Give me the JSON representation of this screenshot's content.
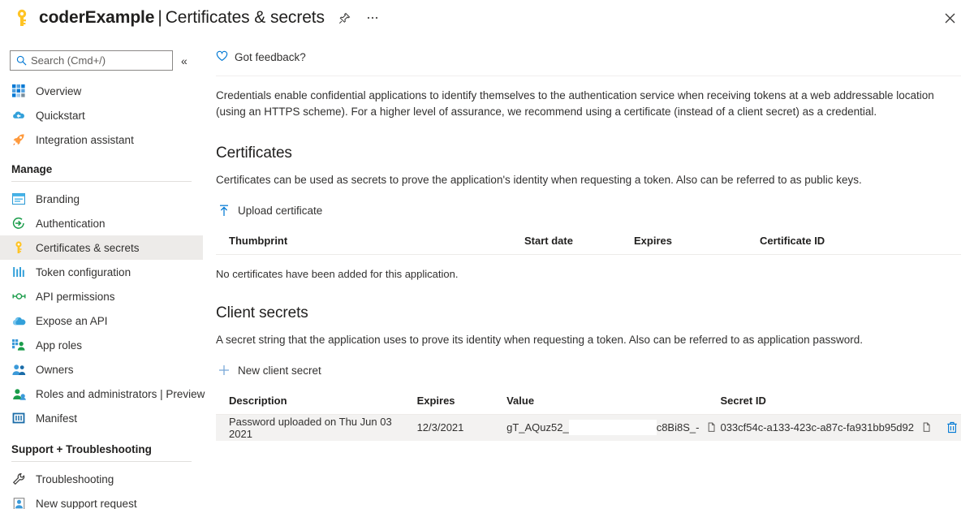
{
  "titlebar": {
    "key_icon": "key-icon",
    "app_name": "coderExample",
    "separator": "|",
    "page_name": "Certificates & secrets",
    "pin_icon": "pin-icon",
    "more_icon": "ellipsis-icon",
    "close_icon": "close-icon"
  },
  "sidebar": {
    "search": {
      "placeholder": "Search (Cmd+/)",
      "value": "",
      "icon": "search-icon"
    },
    "collapse_icon": "chevron-double-left-icon",
    "top_items": [
      {
        "label": "Overview",
        "icon": "overview-grid-icon",
        "selected": false
      },
      {
        "label": "Quickstart",
        "icon": "quickstart-cloud-icon",
        "selected": false
      },
      {
        "label": "Integration assistant",
        "icon": "rocket-icon",
        "selected": false
      }
    ],
    "groups": [
      {
        "title": "Manage",
        "items": [
          {
            "label": "Branding",
            "icon": "branding-window-icon",
            "selected": false
          },
          {
            "label": "Authentication",
            "icon": "authentication-arrow-icon",
            "selected": false
          },
          {
            "label": "Certificates & secrets",
            "icon": "key-icon",
            "selected": true
          },
          {
            "label": "Token configuration",
            "icon": "token-bars-icon",
            "selected": false
          },
          {
            "label": "API permissions",
            "icon": "api-permissions-icon",
            "selected": false
          },
          {
            "label": "Expose an API",
            "icon": "expose-api-cloud-icon",
            "selected": false
          },
          {
            "label": "App roles",
            "icon": "app-roles-icon",
            "selected": false
          },
          {
            "label": "Owners",
            "icon": "owners-people-icon",
            "selected": false
          },
          {
            "label": "Roles and administrators | Preview",
            "icon": "roles-admin-icon",
            "selected": false
          },
          {
            "label": "Manifest",
            "icon": "manifest-icon",
            "selected": false
          }
        ]
      },
      {
        "title": "Support + Troubleshooting",
        "items": [
          {
            "label": "Troubleshooting",
            "icon": "wrench-icon",
            "selected": false
          },
          {
            "label": "New support request",
            "icon": "support-person-icon",
            "selected": false
          }
        ]
      }
    ]
  },
  "main": {
    "feedback": {
      "label": "Got feedback?",
      "icon": "heart-icon"
    },
    "intro": "Credentials enable confidential applications to identify themselves to the authentication service when receiving tokens at a web addressable location (using an HTTPS scheme). For a higher level of assurance, we recommend using a certificate (instead of a client secret) as a credential.",
    "certificates": {
      "title": "Certificates",
      "description": "Certificates can be used as secrets to prove the application's identity when requesting a token. Also can be referred to as public keys.",
      "upload_button": {
        "label": "Upload certificate",
        "icon": "upload-icon"
      },
      "columns": [
        "Thumbprint",
        "Start date",
        "Expires",
        "Certificate ID"
      ],
      "rows": [],
      "empty_message": "No certificates have been added for this application."
    },
    "client_secrets": {
      "title": "Client secrets",
      "description": "A secret string that the application uses to prove its identity when requesting a token. Also can be referred to as application password.",
      "new_button": {
        "label": "New client secret",
        "icon": "plus-icon"
      },
      "columns": [
        "Description",
        "Expires",
        "Value",
        "Secret ID"
      ],
      "rows": [
        {
          "description": "Password uploaded on Thu Jun 03 2021",
          "expires": "12/3/2021",
          "value_prefix": "gT_AQuz52_",
          "value_suffix": "c8Bi8S_-",
          "value_copy_icon": "copy-icon",
          "secret_id": "033cf54c-a133-423c-a87c-fa931bb95d92",
          "secret_copy_icon": "copy-icon",
          "delete_icon": "trash-icon"
        }
      ]
    }
  },
  "colors": {
    "accent": "#0078d4",
    "key_gold": "#ffb900",
    "selected_row": "#f3f2f1",
    "text": "#323130"
  }
}
